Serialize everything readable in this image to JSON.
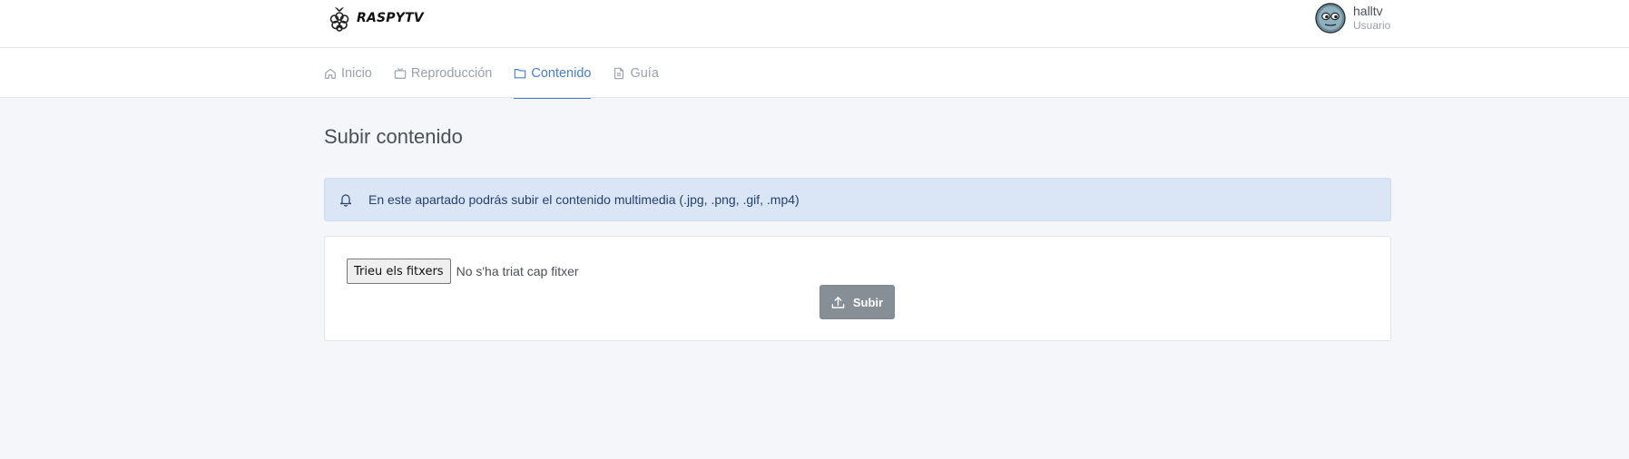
{
  "header": {
    "logo_text": "RASPYTV",
    "user": {
      "name": "halltv",
      "role": "Usuario"
    }
  },
  "nav": {
    "tabs": [
      {
        "label": "Inicio",
        "icon": "home-icon",
        "active": false
      },
      {
        "label": "Reproducción",
        "icon": "tv-icon",
        "active": false
      },
      {
        "label": "Contenido",
        "icon": "folder-icon",
        "active": true
      },
      {
        "label": "Guía",
        "icon": "file-text-icon",
        "active": false
      }
    ]
  },
  "main": {
    "title": "Subir contenido",
    "alert": {
      "icon": "bell-icon",
      "text": "En este apartado podrás subir el contenido multimedia (.jpg, .png, .gif, .mp4)"
    },
    "upload": {
      "file_button_label": "Trieu els fitxers",
      "file_status": "No s'ha triat cap fitxer",
      "submit_label": "Subir",
      "submit_icon": "upload-icon"
    }
  },
  "colors": {
    "accent": "#467fcf",
    "alert_bg": "#dae5f5",
    "button_bg": "#868e96",
    "page_bg": "#f4f6fa"
  }
}
